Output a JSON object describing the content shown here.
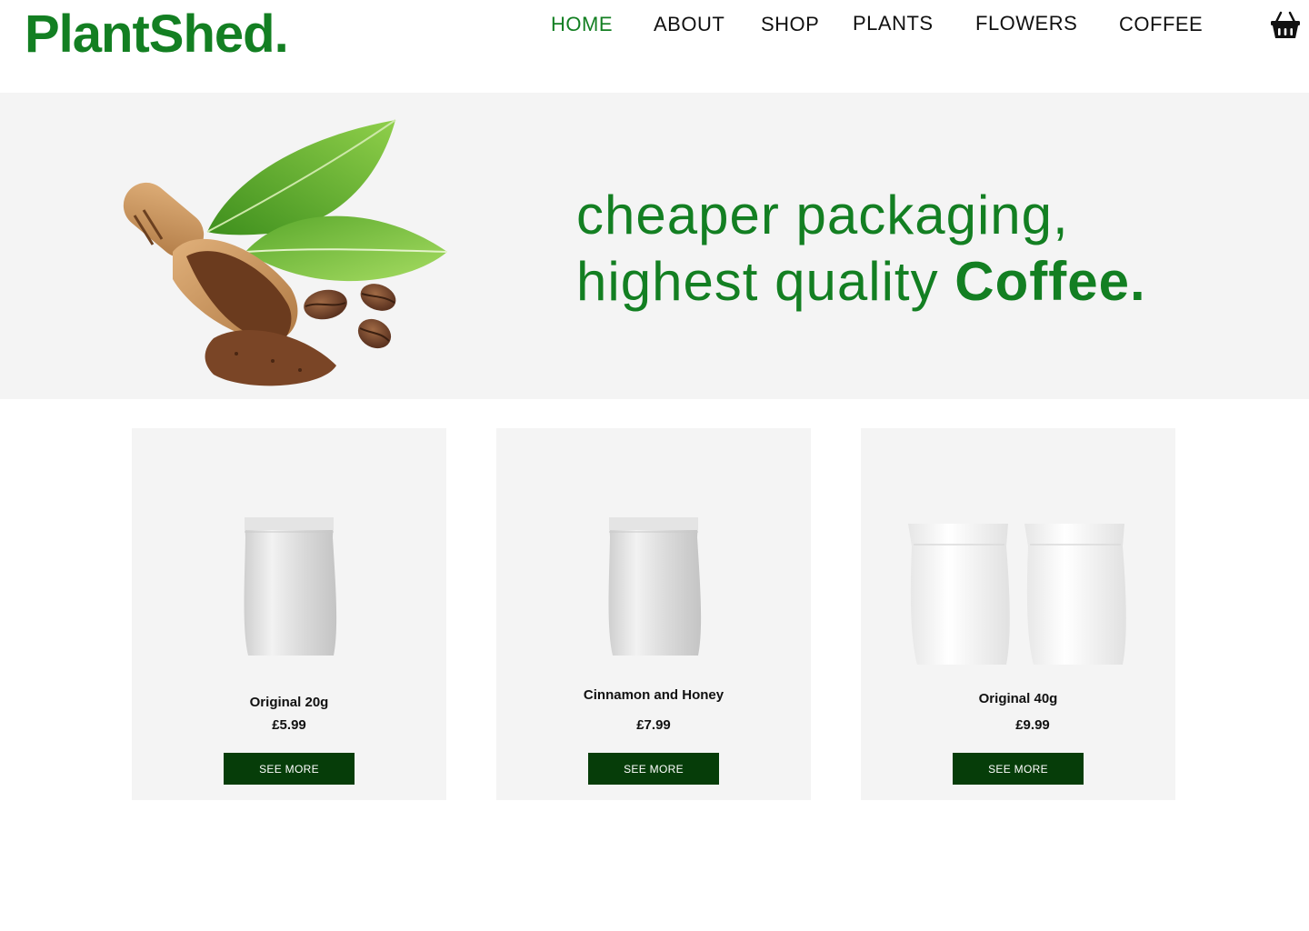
{
  "brand": {
    "name": "PlantShed.",
    "color": "#137f22"
  },
  "nav": {
    "items": [
      {
        "label": "HOME",
        "active": true
      },
      {
        "label": "ABOUT",
        "active": false
      },
      {
        "label": "SHOP",
        "active": false
      },
      {
        "label": "PLANTS",
        "active": false
      },
      {
        "label": "FLOWERS",
        "active": false
      },
      {
        "label": "COFFEE",
        "active": false
      }
    ],
    "cart_icon": "basket-icon"
  },
  "hero": {
    "line1": "cheaper packaging,",
    "line2_regular": "highest quality ",
    "line2_bold": "Coffee.",
    "image": "coffee-scoop-with-leaves-and-beans",
    "background": "#f4f4f4"
  },
  "products": [
    {
      "name": "Original 20g",
      "price": "£5.99",
      "button": "SEE MORE",
      "image": "silver-pouch"
    },
    {
      "name": "Cinnamon and Honey",
      "price": "£7.99",
      "button": "SEE MORE",
      "image": "silver-pouch"
    },
    {
      "name": "Original 40g",
      "price": "£9.99",
      "button": "SEE MORE",
      "image": "white-pouches-pair"
    }
  ],
  "colors": {
    "accent": "#137f22",
    "button": "#063d09",
    "panel": "#f4f4f4"
  }
}
